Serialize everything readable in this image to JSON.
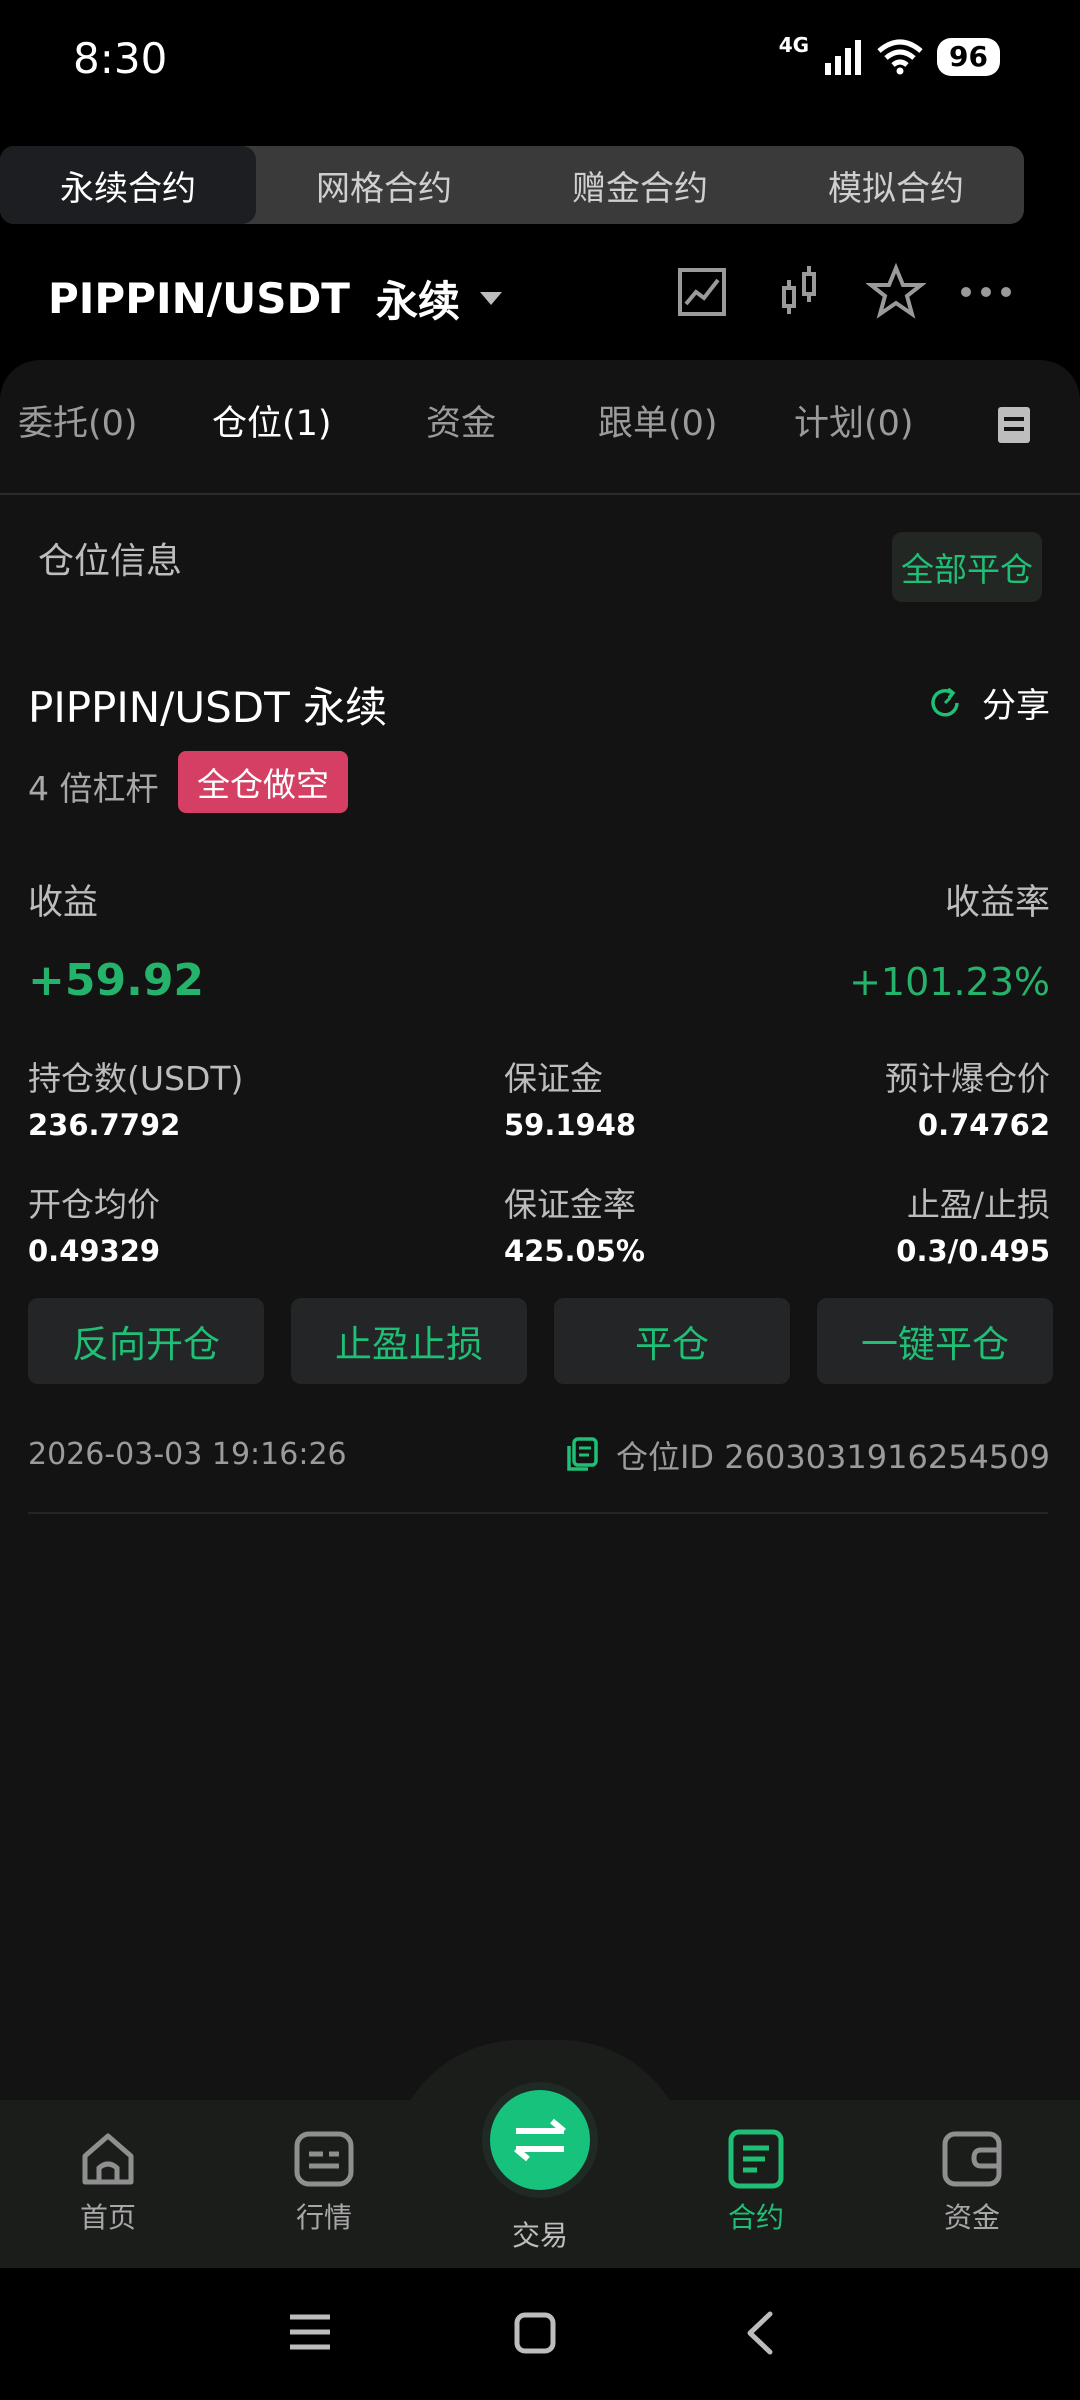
{
  "status_bar": {
    "time": "8:30",
    "network": "4G",
    "battery": "96"
  },
  "segments": [
    {
      "label": "永续合约",
      "active": true
    },
    {
      "label": "网格合约",
      "active": false
    },
    {
      "label": "赠金合约",
      "active": false
    },
    {
      "label": "模拟合约",
      "active": false
    }
  ],
  "header": {
    "pair": "PIPPIN/USDT",
    "type": "永续"
  },
  "tabs": {
    "orders": "委托(0)",
    "positions": "仓位(1)",
    "funds": "资金",
    "copy": "跟单(0)",
    "plan": "计划(0)"
  },
  "section": {
    "title": "仓位信息",
    "close_all": "全部平仓"
  },
  "position": {
    "name": "PIPPIN/USDT 永续",
    "share": "分享",
    "leverage": "4 倍杠杆",
    "side": "全仓做空",
    "pnl_label": "收益",
    "pnl_value": "+59.92",
    "roe_label": "收益率",
    "roe_value": "+101.23%",
    "size_label": "持仓数(USDT)",
    "size_value": "236.7792",
    "margin_label": "保证金",
    "margin_value": "59.1948",
    "liq_label": "预计爆仓价",
    "liq_value": "0.74762",
    "entry_label": "开仓均价",
    "entry_value": "0.49329",
    "margin_ratio_label": "保证金率",
    "margin_ratio_value": "425.05%",
    "tpsl_label": "止盈/止损",
    "tpsl_value": "0.3/0.495",
    "timestamp": "2026-03-03 19:16:26",
    "position_id": "仓位ID 2603031916254509"
  },
  "actions": {
    "reverse": "反向开仓",
    "tpsl": "止盈止损",
    "close": "平仓",
    "quick_close": "一键平仓"
  },
  "bottom_nav": {
    "home": "首页",
    "market": "行情",
    "trade": "交易",
    "futures": "合约",
    "assets": "资金"
  },
  "colors": {
    "accent": "#1fbf76",
    "short": "#d53f63",
    "profit": "#25b26a"
  }
}
